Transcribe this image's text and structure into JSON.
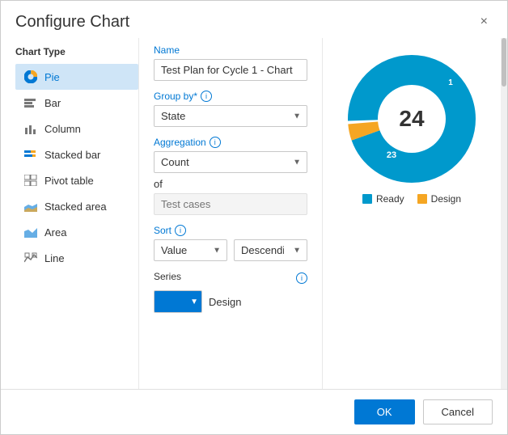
{
  "dialog": {
    "title": "Configure Chart",
    "close_label": "×"
  },
  "chart_types": {
    "label": "Chart Type",
    "items": [
      {
        "id": "pie",
        "label": "Pie",
        "active": true
      },
      {
        "id": "bar",
        "label": "Bar",
        "active": false
      },
      {
        "id": "column",
        "label": "Column",
        "active": false
      },
      {
        "id": "stacked-bar",
        "label": "Stacked bar",
        "active": false
      },
      {
        "id": "pivot-table",
        "label": "Pivot table",
        "active": false
      },
      {
        "id": "stacked-area",
        "label": "Stacked area",
        "active": false
      },
      {
        "id": "area",
        "label": "Area",
        "active": false
      },
      {
        "id": "line",
        "label": "Line",
        "active": false
      }
    ]
  },
  "form": {
    "name_label": "Name",
    "name_value": "Test Plan for Cycle 1 - Chart",
    "group_by_label": "Group by*",
    "group_by_value": "State",
    "aggregation_label": "Aggregation",
    "aggregation_value": "Count",
    "of_label": "of",
    "of_placeholder": "Test cases",
    "sort_label": "Sort",
    "sort_value": "Value",
    "sort_direction_value": "Descending",
    "series_label": "Series",
    "series_item": "Design"
  },
  "chart": {
    "total": "24",
    "segments": [
      {
        "label": "Ready",
        "value": 23,
        "percent": 95.8,
        "color": "#0099cc"
      },
      {
        "label": "Design",
        "value": 1,
        "percent": 4.2,
        "color": "#f5a623"
      }
    ],
    "label_1": "1",
    "label_23": "23"
  },
  "footer": {
    "ok_label": "OK",
    "cancel_label": "Cancel"
  }
}
